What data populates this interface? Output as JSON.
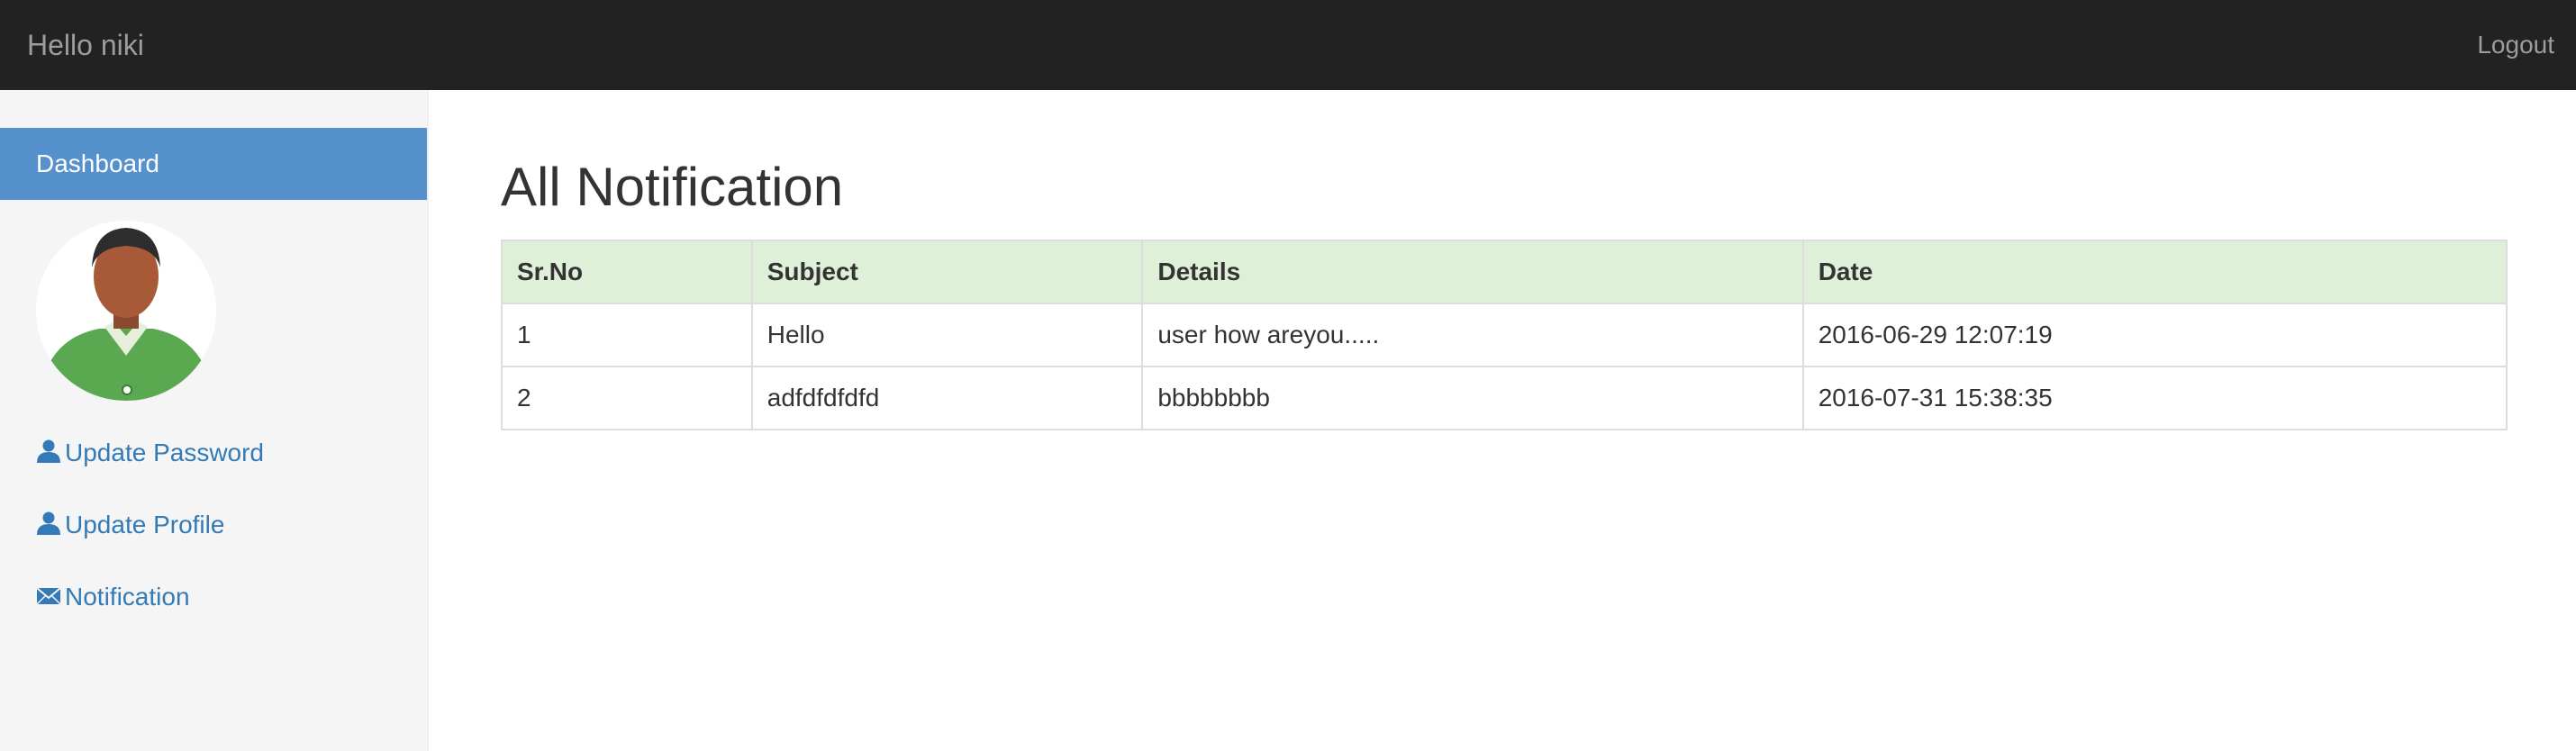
{
  "navbar": {
    "brand": "Hello niki",
    "logout_label": "Logout"
  },
  "sidebar": {
    "active_item": "Dashboard",
    "links": [
      {
        "label": "Update Password",
        "icon": "user-icon"
      },
      {
        "label": "Update Profile",
        "icon": "user-icon"
      },
      {
        "label": "Notification",
        "icon": "envelope-icon"
      }
    ]
  },
  "main": {
    "title": "All Notification",
    "table": {
      "headers": [
        "Sr.No",
        "Subject",
        "Details",
        "Date"
      ],
      "rows": [
        [
          "1",
          "Hello",
          "user how areyou.....",
          "2016-06-29 12:07:19"
        ],
        [
          "2",
          "adfdfdfdfd",
          "bbbbbbbb",
          "2016-07-31 15:38:35"
        ]
      ]
    }
  },
  "colors": {
    "navbar_bg": "#222222",
    "active_item_bg": "#5591cd",
    "link": "#337ab7",
    "table_header_bg": "#dff0d8"
  }
}
